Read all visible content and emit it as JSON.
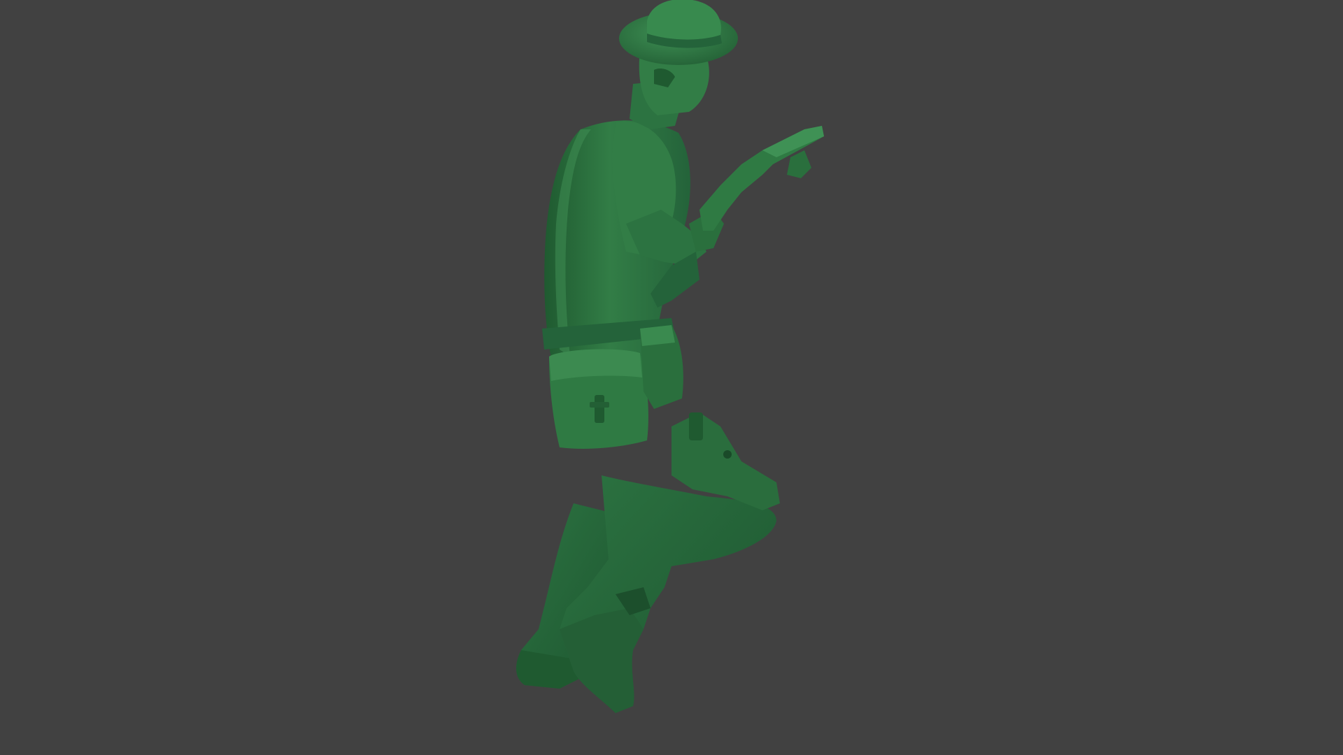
{
  "scene": {
    "background_color": "#414141",
    "subject": "green-toy-soldier-model",
    "colors": {
      "base_green": "#2f7a43",
      "shadow_green": "#1f5a30",
      "highlight_green": "#4a9a5e",
      "deep_shadow": "#174524"
    }
  }
}
